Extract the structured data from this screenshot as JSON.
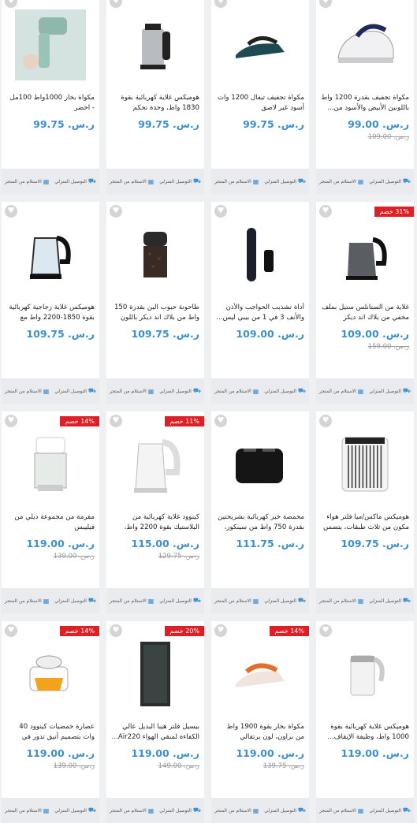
{
  "labels": {
    "home_delivery": "التوصيل المنزلي",
    "store_pickup": "الاستلام من المتجر",
    "currency": "ر.س."
  },
  "colors": {
    "accent": "#3a8fcf",
    "badge": "#e01e25",
    "background": "#eef0f2"
  },
  "products": [
    {
      "title": "مكواة تجفيف بقدرة 1200 واط باللونين الأبيض والأسود من...",
      "price": "ر.س. 99.00",
      "old_price": "ر.س. 109.00",
      "badge": "",
      "icon": "steam-iron-white-icon"
    },
    {
      "title": "مكواة تجفيف تيفال 1200 وات أسود غير لاصق",
      "price": "ر.س. 99.75",
      "old_price": "",
      "badge": "",
      "icon": "steam-iron-dark-icon"
    },
    {
      "title": "هوميكس غلاية كهربائية بقوة 1830 واط، وحدة تحكم رقمية...",
      "price": "ر.س. 99.75",
      "old_price": "",
      "badge": "",
      "icon": "steel-kettle-icon"
    },
    {
      "title": "مكواة بخار 1000واط 100مل - اخضر",
      "price": "ر.س. 99.75",
      "old_price": "",
      "badge": "",
      "icon": "garment-steamer-icon"
    },
    {
      "title": "غلاية من الستانلس ستيل بملف مخفي من بلاك اند ديكر بقدرة...",
      "price": "ر.س. 109.00",
      "old_price": "ر.س. 159.00",
      "badge": "31% خصم",
      "icon": "black-kettle-icon"
    },
    {
      "title": "أداة تشذيب الحواجب والأذن والأنف 3 في 1 من بيبي ليس...",
      "price": "ر.س. 109.00",
      "old_price": "",
      "badge": "",
      "icon": "nose-trimmer-icon"
    },
    {
      "title": "طاحونة حبوب البن بقدرة 150 واط من بلاك اند ديكر باللون البني",
      "price": "ر.س. 109.75",
      "old_price": "",
      "badge": "",
      "icon": "coffee-grinder-icon"
    },
    {
      "title": "هوميكس غلاية زجاجية كهربائية بقوة 1850-2200 واط مع وظيفة...",
      "price": "ر.س. 109.75",
      "old_price": "",
      "badge": "",
      "icon": "glass-kettle-icon"
    },
    {
      "title": "هوميكس ماكس/ميا فلتر هواء مكون من ثلاث طبقات، يتضمن فلـ...",
      "price": "ر.س. 109.75",
      "old_price": "",
      "badge": "",
      "icon": "air-filter-icon"
    },
    {
      "title": "محمصة خبز كهربائية بشريحتين بقدرة 750 واط من سينكور، لون...",
      "price": "ر.س. 111.75",
      "old_price": "",
      "badge": "",
      "icon": "toaster-icon"
    },
    {
      "title": "كينوود غلاية كهربائية من البلاستيك بقوة 2200 واط، مع...",
      "price": "ر.س. 115.00",
      "old_price": "ر.س. 129.75",
      "badge": "11% خصم",
      "icon": "white-kettle-icon"
    },
    {
      "title": "مفرمة من مجموعة ديلي من فيليبس",
      "price": "ر.س. 119.00",
      "old_price": "ر.س. 139.00",
      "badge": "14% خصم",
      "icon": "chopper-icon"
    },
    {
      "title": "هوميكس غلاية كهربائية بقوة 1000 واط، وظيفة الإيقاف...",
      "price": "ر.س. 119.00",
      "old_price": "",
      "badge": "",
      "icon": "travel-kettle-icon"
    },
    {
      "title": "مكواة بخار بقوة 1900 واط من براون، لون برتقالي وابيض...",
      "price": "ر.س. 119.00",
      "old_price": "ر.س. 139.75",
      "badge": "14% خصم",
      "icon": "orange-iron-icon"
    },
    {
      "title": "بيسيل فلتر هيبا البديل عالي الكفاءة لمنقي الهواء Air220...",
      "price": "ر.س. 119.00",
      "old_price": "ر.س. 149.00",
      "badge": "20% خصم",
      "icon": "hepa-filter-icon"
    },
    {
      "title": "عصارة حمضيات كينوود 40 وات بتصميم أنيق تدور في الاتجاهين...",
      "price": "ر.س. 119.00",
      "old_price": "ر.س. 139.00",
      "badge": "14% خصم",
      "icon": "citrus-juicer-icon"
    }
  ]
}
